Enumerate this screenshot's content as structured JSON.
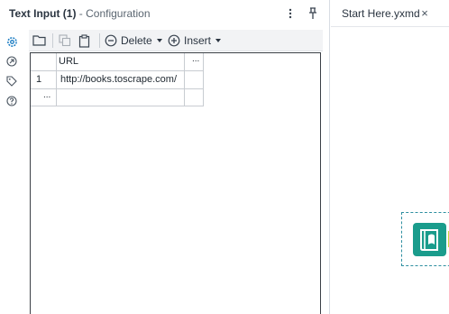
{
  "config_panel": {
    "title": "Text Input (1)",
    "subtitle": "- Configuration",
    "toolbar": {
      "delete_label": "Delete",
      "insert_label": "Insert"
    },
    "grid": {
      "headers": [
        "",
        "URL",
        "..."
      ],
      "rows": [
        {
          "num": "1",
          "url": "http://books.toscrape.com/"
        }
      ],
      "new_row_marker": "..."
    }
  },
  "tab": {
    "label": "Start Here.yxmd",
    "close": "×"
  },
  "icons": {
    "header": [
      "more-vertical-icon",
      "pin-icon"
    ],
    "rail": [
      "gear-icon",
      "arrow-circle-icon",
      "tag-icon",
      "help-icon"
    ],
    "toolbar": [
      "folder-open-icon",
      "copy-icon",
      "clipboard-icon",
      "minus-circle-icon",
      "plus-circle-icon"
    ],
    "canvas": [
      "book-tool-icon"
    ]
  },
  "colors": {
    "accent": "#1f7fc4",
    "tool": "#1a9c8c",
    "tool_output": "#c9d63f"
  }
}
